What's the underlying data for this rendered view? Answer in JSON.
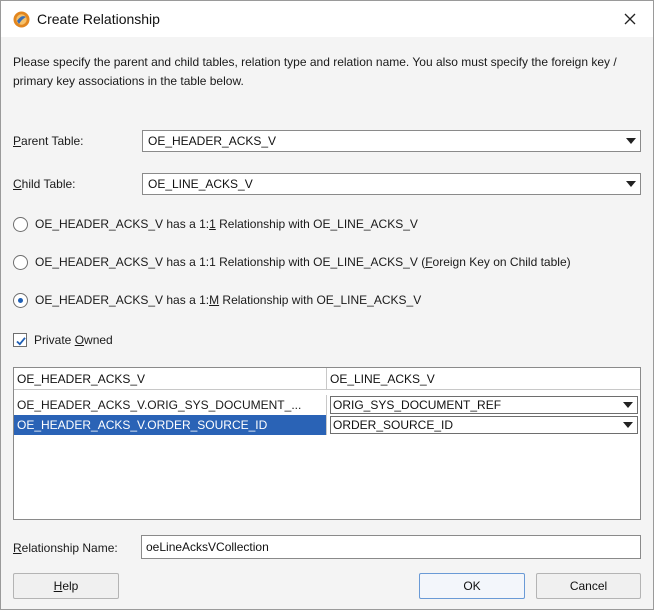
{
  "window": {
    "title": "Create Relationship",
    "accent": "#2a63b6"
  },
  "description": "Please specify the parent and child tables, relation type and relation name.  You also must specify the foreign key / primary key associations in the table below.",
  "parent_table": {
    "label_mnemonic": "P",
    "label_rest": "arent Table:",
    "value": "OE_HEADER_ACKS_V"
  },
  "child_table": {
    "label_mnemonic": "C",
    "label_rest": "hild Table:",
    "value": "OE_LINE_ACKS_V"
  },
  "relationship_options": [
    {
      "pre": "OE_HEADER_ACKS_V has a 1:",
      "mnemonic": "1",
      "post": " Relationship with OE_LINE_ACKS_V",
      "selected": false
    },
    {
      "pre": "OE_HEADER_ACKS_V has a 1:1 Relationship with OE_LINE_ACKS_V (",
      "mnemonic": "F",
      "post": "oreign Key on Child table)",
      "selected": false
    },
    {
      "pre": "OE_HEADER_ACKS_V has a 1:",
      "mnemonic": "M",
      "post": " Relationship with OE_LINE_ACKS_V",
      "selected": true
    }
  ],
  "private_owned": {
    "pre": "Private ",
    "mnemonic": "O",
    "post": "wned",
    "checked": true
  },
  "key_table": {
    "columns": [
      "OE_HEADER_ACKS_V",
      "OE_LINE_ACKS_V"
    ],
    "rows": [
      {
        "parent": "OE_HEADER_ACKS_V.ORIG_SYS_DOCUMENT_...",
        "child": "ORIG_SYS_DOCUMENT_REF",
        "selected": false
      },
      {
        "parent": "OE_HEADER_ACKS_V.ORDER_SOURCE_ID",
        "child": "ORDER_SOURCE_ID",
        "selected": true
      }
    ]
  },
  "relationship_name": {
    "label_mnemonic": "R",
    "label_rest": "elationship Name:",
    "value": "oeLineAcksVCollection"
  },
  "buttons": {
    "help_mnemonic": "H",
    "help_rest": "elp",
    "ok": "OK",
    "cancel": "Cancel"
  }
}
